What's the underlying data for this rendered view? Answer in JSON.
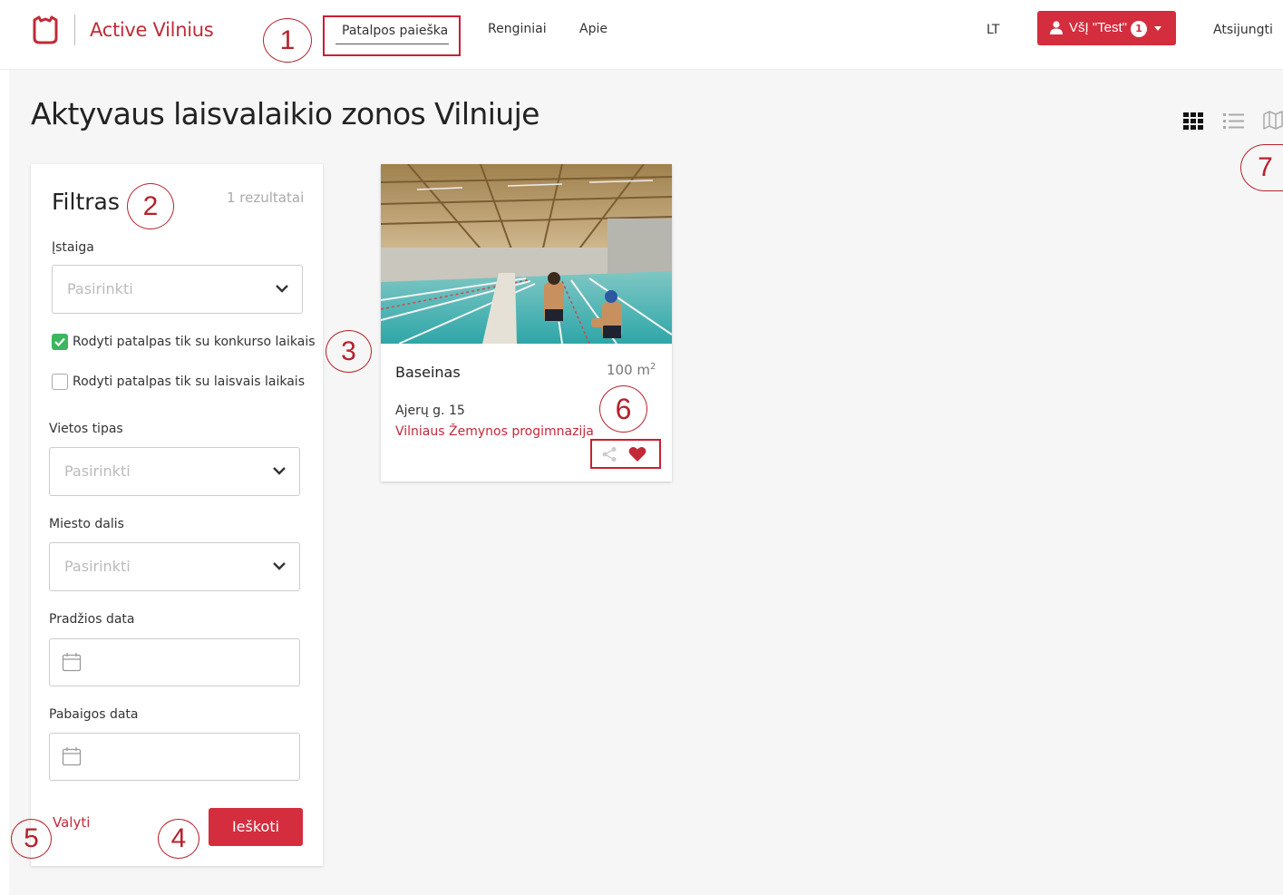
{
  "header": {
    "brand": "Active Vilnius",
    "nav": [
      "Patalpos paieška",
      "Renginiai",
      "Apie"
    ],
    "language": "LT",
    "user_label": "VšĮ \"Test\"",
    "user_badge": "1",
    "logout": "Atsijungti"
  },
  "page": {
    "title": "Aktyvaus laisvalaikio zonos Vilniuje",
    "view_modes": [
      "grid-icon",
      "list-icon",
      "map-icon"
    ],
    "active_view": "grid"
  },
  "filter": {
    "title": "Filtras",
    "result_count": "1 rezultatai",
    "institution_label": "Įstaiga",
    "institution_placeholder": "Pasirinkti",
    "check_competition_label": "Rodyti patalpas tik su konkurso laikais",
    "check_competition_checked": true,
    "check_free_label": "Rodyti patalpas tik su laisvais laikais",
    "check_free_checked": false,
    "place_type_label": "Vietos tipas",
    "place_type_placeholder": "Pasirinkti",
    "district_label": "Miesto dalis",
    "district_placeholder": "Pasirinkti",
    "start_date_label": "Pradžios data",
    "end_date_label": "Pabaigos data",
    "clear_label": "Valyti",
    "search_label": "Ieškoti"
  },
  "results": [
    {
      "name": "Baseinas",
      "area": "100 m",
      "area_unit_sup": "2",
      "address": "Ajerų g. 15",
      "organization": "Vilniaus Žemynos progimnazija"
    }
  ],
  "annotations": [
    "1",
    "2",
    "3",
    "4",
    "5",
    "6",
    "7"
  ],
  "colors": {
    "accent": "#d42d3e",
    "annotation": "#b5222d",
    "checkbox_on": "#3cb55e",
    "background": "#f6f6f6"
  }
}
